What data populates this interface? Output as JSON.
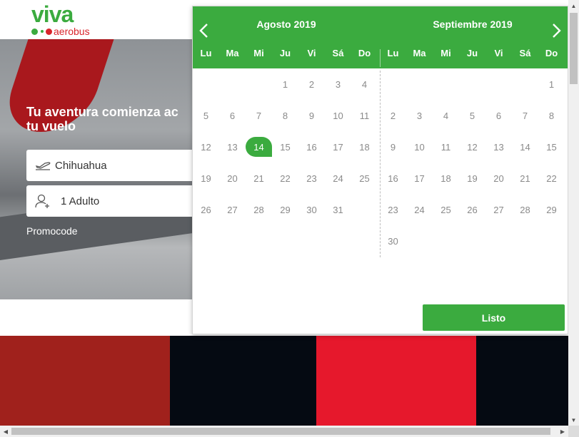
{
  "header": {
    "logo_main": "viva",
    "logo_sub": "aerobus"
  },
  "hero": {
    "title": "Tu aventura comienza ac\ntu vuelo",
    "origin_value": "Chihuahua",
    "passengers_value": "1 Adulto",
    "promocode_label": "Promocode"
  },
  "calendar": {
    "months": [
      {
        "title": "Agosto 2019",
        "days_of_week": [
          "Lu",
          "Ma",
          "Mi",
          "Ju",
          "Vi",
          "Sá",
          "Do"
        ],
        "leading_blanks": 3,
        "days": [
          "1",
          "2",
          "3",
          "4",
          "5",
          "6",
          "7",
          "8",
          "9",
          "10",
          "11",
          "12",
          "13",
          "14",
          "15",
          "16",
          "17",
          "18",
          "19",
          "20",
          "21",
          "22",
          "23",
          "24",
          "25",
          "26",
          "27",
          "28",
          "29",
          "30",
          "31"
        ],
        "selected_day": "14"
      },
      {
        "title": "Septiembre 2019",
        "days_of_week": [
          "Lu",
          "Ma",
          "Mi",
          "Ju",
          "Vi",
          "Sá",
          "Do"
        ],
        "leading_blanks": 6,
        "days": [
          "1",
          "2",
          "3",
          "4",
          "5",
          "6",
          "7",
          "8",
          "9",
          "10",
          "11",
          "12",
          "13",
          "14",
          "15",
          "16",
          "17",
          "18",
          "19",
          "20",
          "21",
          "22",
          "23",
          "24",
          "25",
          "26",
          "27",
          "28",
          "29",
          "30"
        ],
        "selected_day": null
      }
    ],
    "done_label": "Listo"
  },
  "colors": {
    "brand_green": "#3bab3f",
    "brand_red": "#d9252b"
  },
  "icons": {
    "prev": "chevron-left-icon",
    "next": "chevron-right-icon",
    "origin": "plane-takeoff-icon",
    "passengers": "user-add-icon"
  }
}
